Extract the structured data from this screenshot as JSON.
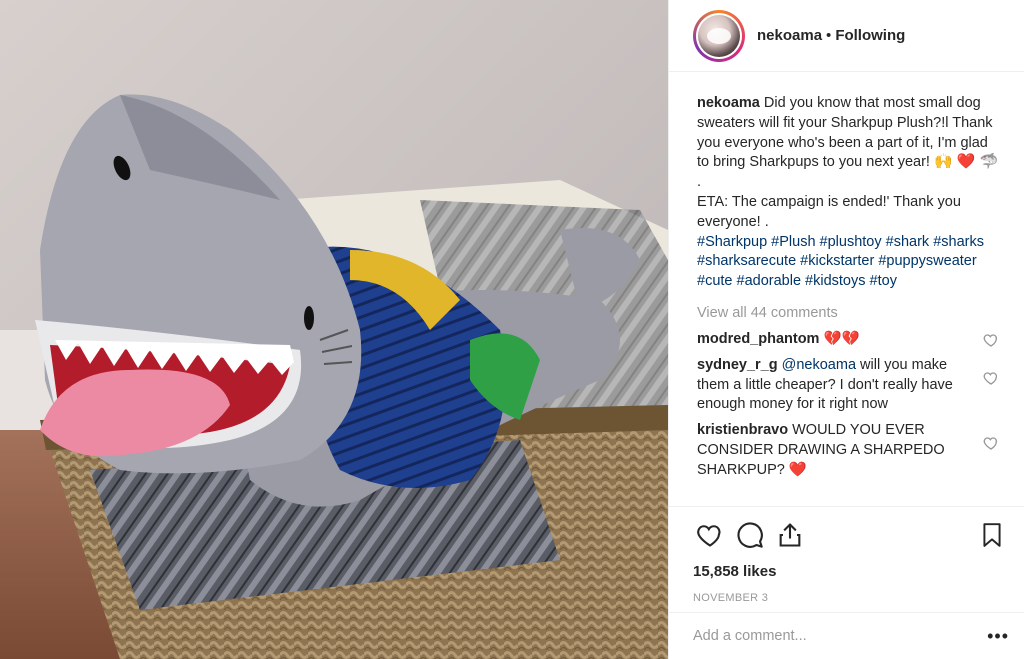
{
  "post": {
    "author": "nekoama",
    "separator": "•",
    "follow_status": "Following",
    "caption": {
      "line1": "Did you know that most small dog sweaters will fit your Sharkpup Plush?!l Thank you everyone who's been a part of it, I'm glad to bring Sharkpups to you next year!",
      "emojis": "🙌 ❤️ 🦈",
      "dot": ".",
      "eta": "ETA: The campaign is ended!' Thank you everyone! ."
    },
    "hashtags": [
      "#Sharkpup",
      "#Plush",
      "#plushtoy",
      "#shark",
      "#sharks",
      "#sharksarecute",
      "#kickstarter",
      "#puppysweater",
      "#cute",
      "#adorable",
      "#kidstoys",
      "#toy"
    ],
    "view_all_comments": "View all 44 comments",
    "comments": [
      {
        "user": "modred_phantom",
        "text": "💔💔"
      },
      {
        "user": "sydney_r_g",
        "mention": "@nekoama",
        "text": "will you make them a little cheaper? I don't really have enough money for it right now"
      },
      {
        "user": "kristienbravo",
        "text": "WOULD YOU EVER CONSIDER DRAWING A SHARPEDO SHARKPUP? ❤️"
      }
    ],
    "likes": "15,858 likes",
    "date": "NOVEMBER 3",
    "add_comment_placeholder": "Add a comment...",
    "more_options": "•••"
  },
  "icons": {
    "like": "heart-icon",
    "comment": "comment-icon",
    "share": "share-icon",
    "save": "bookmark-icon"
  },
  "colors": {
    "hashtag": "#003569",
    "muted": "#999999",
    "text": "#262626",
    "border": "#efefef"
  }
}
